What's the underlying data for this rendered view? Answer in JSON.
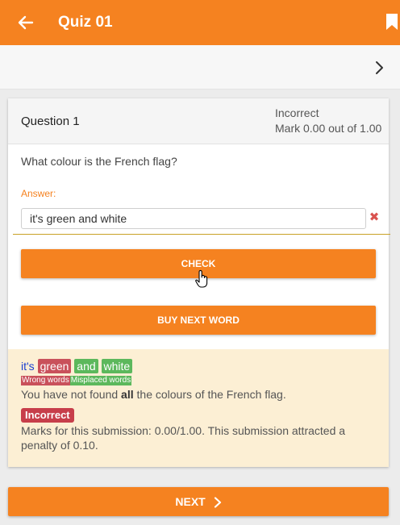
{
  "header": {
    "title": "Quiz 01"
  },
  "question": {
    "title": "Question 1",
    "state": "Incorrect",
    "mark": "Mark 0.00 out of 1.00",
    "text": "What colour is the French flag?",
    "answer_label": "Answer:",
    "answer_value": "it's green and white",
    "check_label": "CHECK",
    "buy_label": "BUY NEXT WORD"
  },
  "feedback": {
    "tokens": [
      "it's",
      "green",
      "and",
      "white"
    ],
    "legend_wrong": "Wrong words",
    "legend_misplaced": "Misplaced words",
    "message_pre": "You have not found ",
    "message_bold": "all",
    "message_post": " the colours of the French flag.",
    "badge": "Incorrect",
    "marks": "Marks for this submission: 0.00/1.00. This submission attracted a penalty of 0.10."
  },
  "footer": {
    "next_label": "NEXT"
  },
  "colors": {
    "accent": "#f58220",
    "wrong": "#c9515b",
    "misplaced": "#5cb85c",
    "feedback_bg": "#fcefd4",
    "incorrect_badge": "#c73e4a"
  }
}
